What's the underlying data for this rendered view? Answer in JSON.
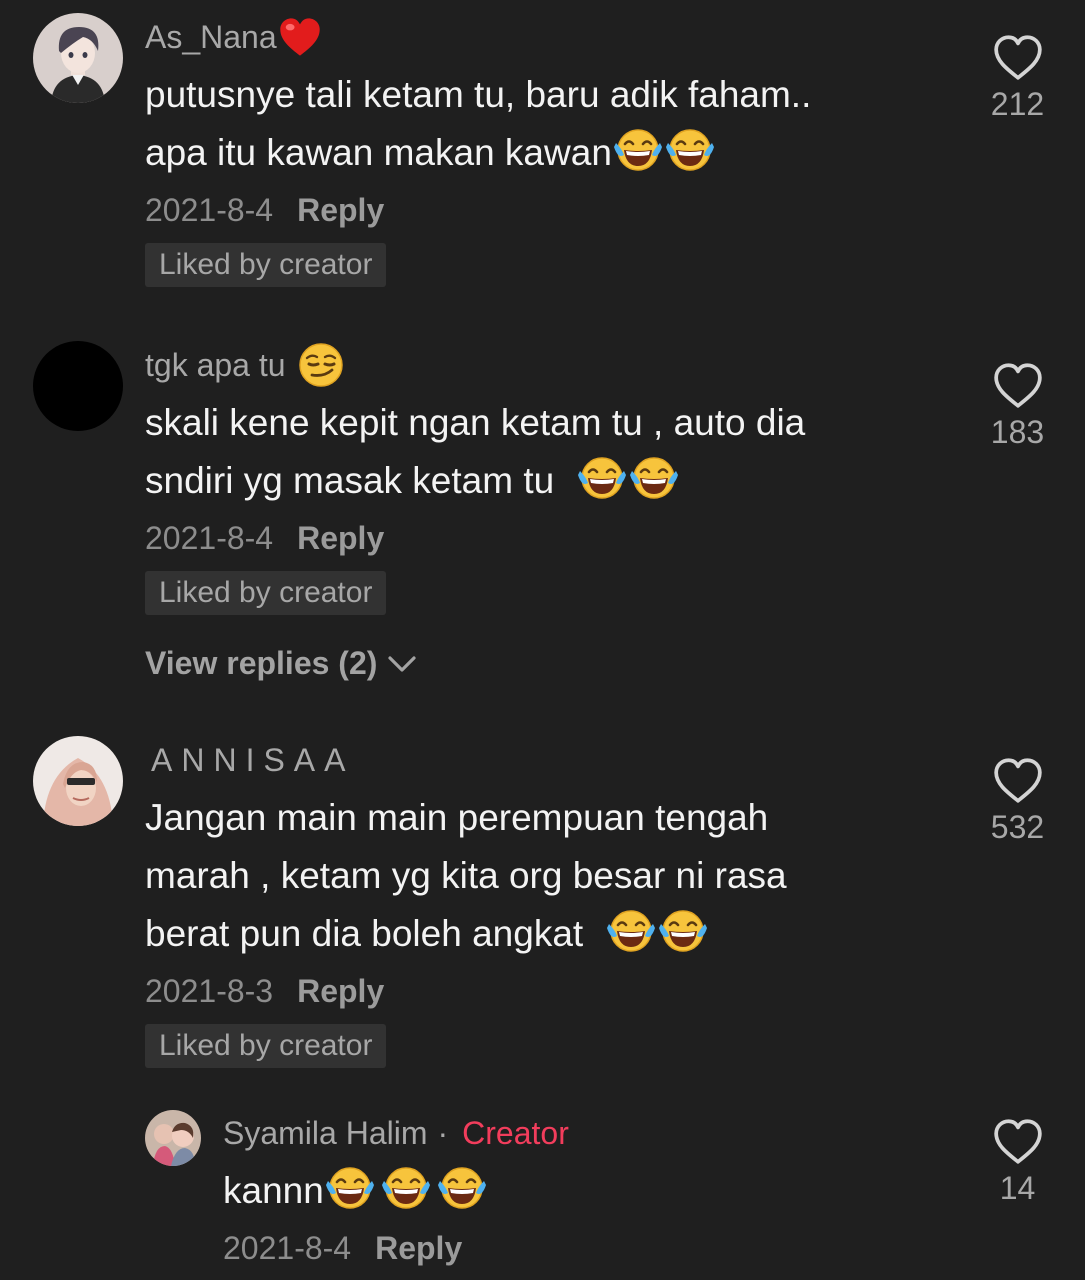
{
  "comments": [
    {
      "username": "As_Nana",
      "username_emoji": "red-heart",
      "text_lines": [
        "putusnye tali ketam tu, baru adik faham..",
        "apa itu kawan makan kawan"
      ],
      "text_emojis": [
        "tears-of-joy",
        "tears-of-joy"
      ],
      "date": "2021-8-4",
      "reply_label": "Reply",
      "badge": "Liked by creator",
      "likes": "212"
    },
    {
      "username": "tgk apa tu",
      "username_emoji": "smirking-face",
      "text_lines": [
        "skali kene kepit ngan ketam tu , auto dia",
        "sndiri yg masak ketam tu "
      ],
      "text_emojis": [
        "tears-of-joy",
        "tears-of-joy"
      ],
      "date": "2021-8-4",
      "reply_label": "Reply",
      "badge": "Liked by creator",
      "view_replies": "View replies (2)",
      "likes": "183"
    },
    {
      "username": "ANNISAA",
      "text_lines": [
        "Jangan main main perempuan tengah",
        "marah , ketam yg kita org besar ni rasa",
        "berat pun dia boleh angkat "
      ],
      "text_emojis": [
        "tears-of-joy",
        "tears-of-joy"
      ],
      "date": "2021-8-3",
      "reply_label": "Reply",
      "badge": "Liked by creator",
      "likes": "532"
    }
  ],
  "reply": {
    "username": "Syamila Halim",
    "separator": "·",
    "creator_label": "Creator",
    "text": "kannn",
    "text_emojis": [
      "tears-of-joy",
      "tears-of-joy",
      "tears-of-joy"
    ],
    "date": "2021-8-4",
    "reply_label": "Reply",
    "likes": "14"
  },
  "icons": {
    "like": "heart-outline-icon",
    "expand": "chevron-down-icon"
  },
  "colors": {
    "background": "#1f1f1f",
    "creator_accent": "#f23d5c",
    "badge_background": "#323232"
  }
}
